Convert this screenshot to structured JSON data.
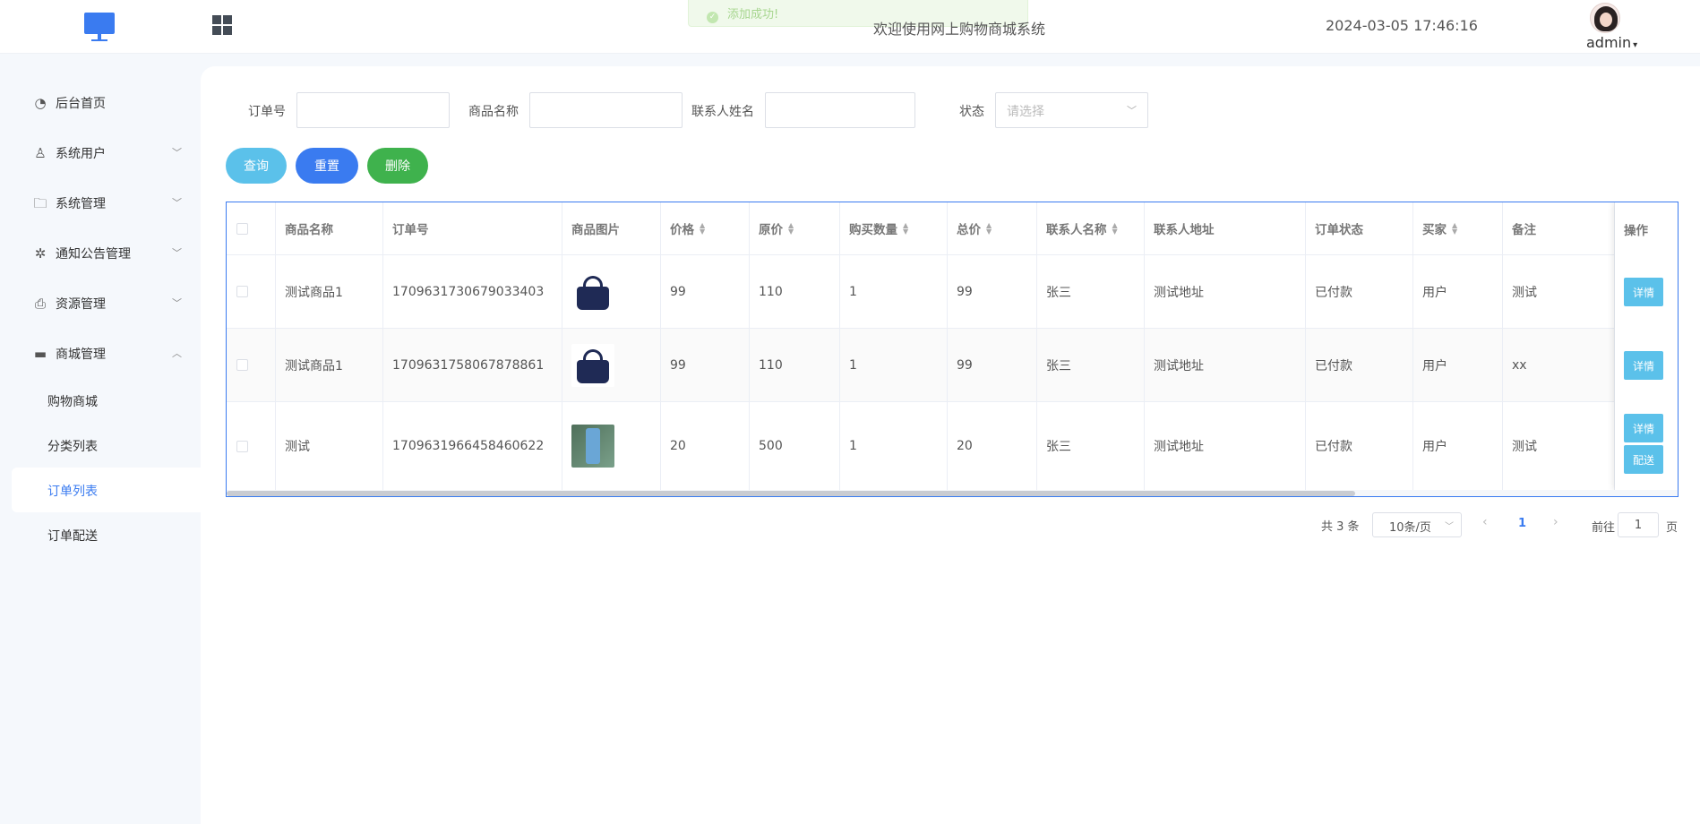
{
  "header": {
    "toast": "添加成功!",
    "welcome": "欢迎使用网上购物商城系统",
    "datetime": "2024-03-05 17:46:16",
    "user": "admin"
  },
  "sidebar": {
    "items": [
      {
        "label": "后台首页",
        "icon": "pie-chart-icon"
      },
      {
        "label": "系统用户",
        "icon": "user-icon"
      },
      {
        "label": "系统管理",
        "icon": "folder-check-icon"
      },
      {
        "label": "通知公告管理",
        "icon": "loading-icon"
      },
      {
        "label": "资源管理",
        "icon": "printer-icon"
      },
      {
        "label": "商城管理",
        "icon": "monitor-icon"
      }
    ],
    "sub_items": [
      {
        "label": "购物商城"
      },
      {
        "label": "分类列表"
      },
      {
        "label": "订单列表"
      },
      {
        "label": "订单配送"
      }
    ]
  },
  "filters": {
    "order_no_label": "订单号",
    "product_name_label": "商品名称",
    "contact_name_label": "联系人姓名",
    "status_label": "状态",
    "status_placeholder": "请选择"
  },
  "buttons": {
    "query": "查询",
    "reset": "重置",
    "delete": "删除"
  },
  "table": {
    "headers": [
      "商品名称",
      "订单号",
      "商品图片",
      "价格",
      "原价",
      "购买数量",
      "总价",
      "联系人名称",
      "联系人地址",
      "订单状态",
      "买家",
      "备注",
      "操作"
    ],
    "rows": [
      {
        "name": "测试商品1",
        "order_no": "1709631730679033403",
        "image": "handbag",
        "price": "99",
        "orig": "110",
        "qty": "1",
        "total": "99",
        "contact": "张三",
        "address": "测试地址",
        "status": "已付款",
        "buyer": "用户",
        "note": "测试",
        "actions": [
          "详情"
        ]
      },
      {
        "name": "测试商品1",
        "order_no": "1709631758067878861",
        "image": "handbag",
        "price": "99",
        "orig": "110",
        "qty": "1",
        "total": "99",
        "contact": "张三",
        "address": "测试地址",
        "status": "已付款",
        "buyer": "用户",
        "note": "xx",
        "actions": [
          "详情"
        ]
      },
      {
        "name": "测试",
        "order_no": "1709631966458460622",
        "image": "water-bottle",
        "price": "20",
        "orig": "500",
        "qty": "1",
        "total": "20",
        "contact": "张三",
        "address": "测试地址",
        "status": "已付款",
        "buyer": "用户",
        "note": "测试",
        "actions": [
          "详情",
          "配送"
        ]
      }
    ]
  },
  "pagination": {
    "total": "共 3 条",
    "page_size": "10条/页",
    "current": "1",
    "goto_label": "前往",
    "goto_value": "1",
    "page_suffix": "页"
  }
}
